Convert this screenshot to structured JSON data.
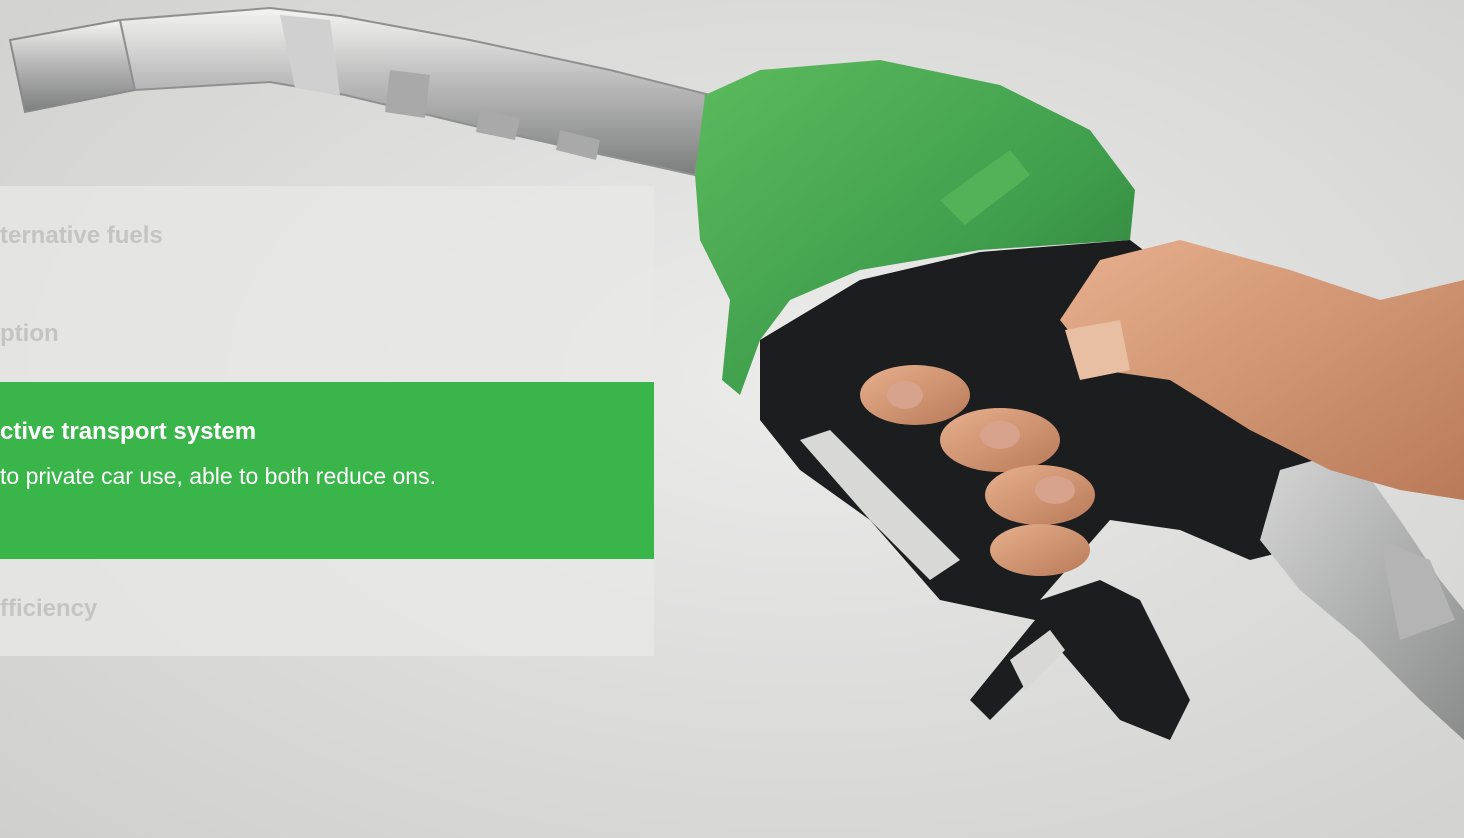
{
  "accordion": {
    "items": [
      {
        "title": "ternative fuels",
        "active": false
      },
      {
        "title": "ption",
        "active": false
      },
      {
        "title": "ctive transport system",
        "active": true,
        "body": "to private car use, able to both reduce ons."
      },
      {
        "title": "fficiency",
        "active": false
      }
    ]
  },
  "colors": {
    "accent_green": "#39b54a",
    "panel_bg": "#e8e8e7",
    "inactive_text": "#c4c4c3",
    "nozzle_green": "#3f9e4c",
    "handle_black": "#1c1d1f"
  },
  "image": {
    "subject": "fuel-pump-nozzle-photo"
  }
}
